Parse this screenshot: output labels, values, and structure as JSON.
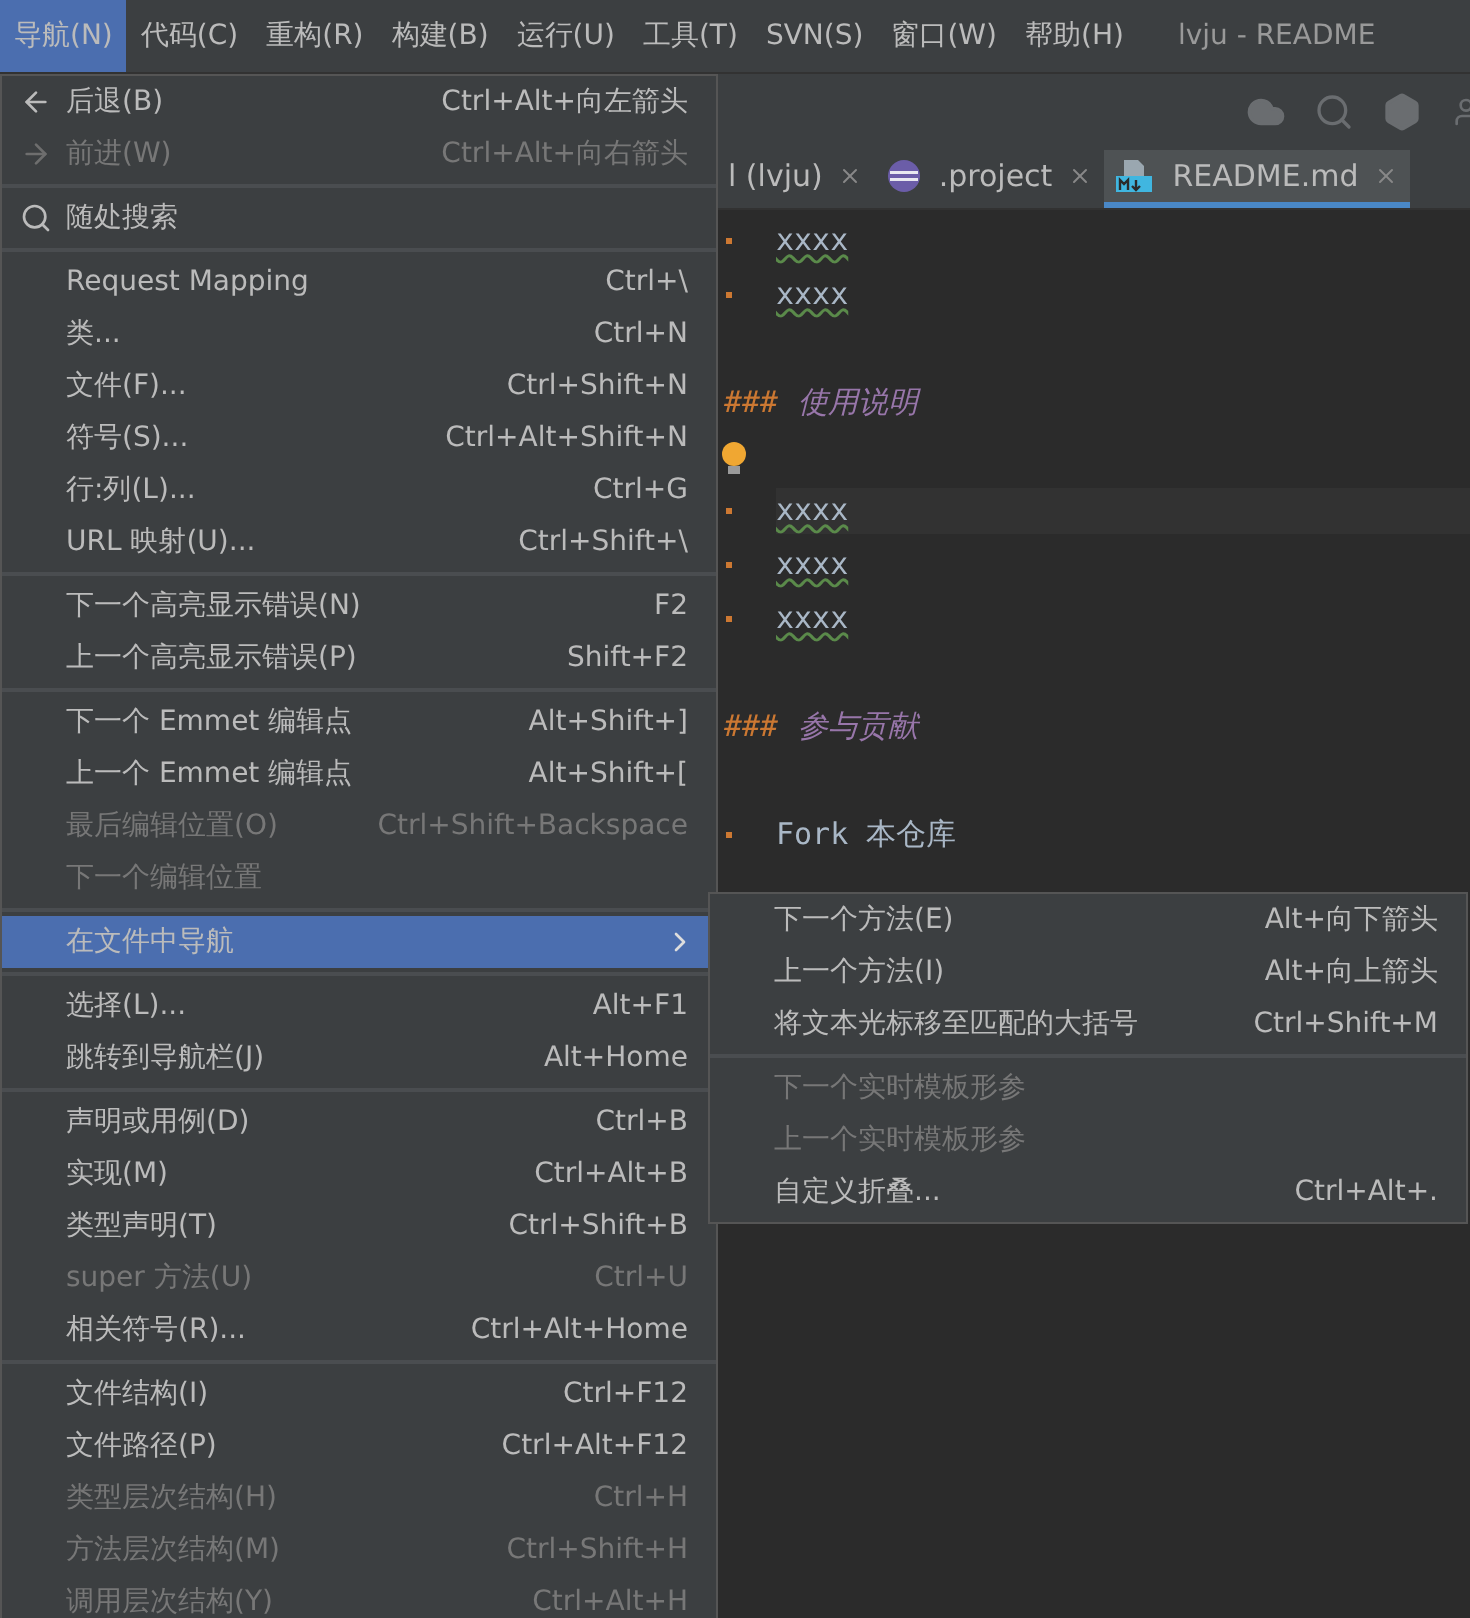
{
  "menubar": {
    "items": [
      {
        "label": "导航(N)",
        "selected": true
      },
      {
        "label": "代码(C)",
        "selected": false
      },
      {
        "label": "重构(R)",
        "selected": false
      },
      {
        "label": "构建(B)",
        "selected": false
      },
      {
        "label": "运行(U)",
        "selected": false
      },
      {
        "label": "工具(T)",
        "selected": false
      },
      {
        "label": "SVN(S)",
        "selected": false
      },
      {
        "label": "窗口(W)",
        "selected": false
      },
      {
        "label": "帮助(H)",
        "selected": false
      }
    ],
    "title": "lvju - README"
  },
  "tabs": [
    {
      "label": "l (lvju)",
      "selected": false,
      "kind": "plain"
    },
    {
      "label": ".project",
      "selected": false,
      "kind": "eclipse"
    },
    {
      "label": "README.md",
      "selected": true,
      "kind": "markdown"
    }
  ],
  "editor": {
    "lines": [
      {
        "kind": "bullet",
        "text": "xxxx",
        "current": false
      },
      {
        "kind": "bullet",
        "text": "xxxx",
        "current": false
      },
      {
        "kind": "blank"
      },
      {
        "kind": "heading",
        "hashes": "###",
        "text": "使用说明"
      },
      {
        "kind": "bulb"
      },
      {
        "kind": "bullet",
        "text": "xxxx",
        "current": true
      },
      {
        "kind": "bullet",
        "text": "xxxx",
        "current": false
      },
      {
        "kind": "bullet",
        "text": "xxxx",
        "current": false
      },
      {
        "kind": "blank"
      },
      {
        "kind": "heading",
        "hashes": "###",
        "text": "参与贡献"
      },
      {
        "kind": "blank"
      },
      {
        "kind": "bullet",
        "text": "Fork 本仓库",
        "current": false,
        "misspelled": false
      }
    ]
  },
  "menu": {
    "groups": [
      [
        {
          "label": "后退(B)",
          "shortcut": "Ctrl+Alt+向左箭头",
          "disabled": false,
          "selected": false,
          "kind": "back"
        },
        {
          "label": "前进(W)",
          "shortcut": "Ctrl+Alt+向右箭头",
          "disabled": true,
          "selected": false,
          "kind": "forward"
        }
      ],
      [
        {
          "label": "随处搜索",
          "disabled": false,
          "selected": false,
          "kind": "search"
        }
      ],
      [
        {
          "label": "Request Mapping",
          "shortcut": "Ctrl+\\",
          "disabled": false,
          "selected": false
        },
        {
          "label": "类...",
          "shortcut": "Ctrl+N",
          "disabled": false,
          "selected": false
        },
        {
          "label": "文件(F)...",
          "shortcut": "Ctrl+Shift+N",
          "disabled": false,
          "selected": false
        },
        {
          "label": "符号(S)...",
          "shortcut": "Ctrl+Alt+Shift+N",
          "disabled": false,
          "selected": false
        },
        {
          "label": "行:列(L)...",
          "shortcut": "Ctrl+G",
          "disabled": false,
          "selected": false
        },
        {
          "label": "URL 映射(U)...",
          "shortcut": "Ctrl+Shift+\\",
          "disabled": false,
          "selected": false
        }
      ],
      [
        {
          "label": "下一个高亮显示错误(N)",
          "shortcut": "F2",
          "disabled": false,
          "selected": false
        },
        {
          "label": "上一个高亮显示错误(P)",
          "shortcut": "Shift+F2",
          "disabled": false,
          "selected": false
        }
      ],
      [
        {
          "label": "下一个 Emmet 编辑点",
          "shortcut": "Alt+Shift+]",
          "disabled": false,
          "selected": false
        },
        {
          "label": "上一个 Emmet 编辑点",
          "shortcut": "Alt+Shift+[",
          "disabled": false,
          "selected": false
        },
        {
          "label": "最后编辑位置(O)",
          "shortcut": "Ctrl+Shift+Backspace",
          "disabled": true,
          "selected": false
        },
        {
          "label": "下一个编辑位置",
          "disabled": true,
          "selected": false
        }
      ],
      [
        {
          "label": "在文件中导航",
          "disabled": false,
          "selected": true,
          "kind": "submenu"
        }
      ],
      [
        {
          "label": "选择(L)...",
          "shortcut": "Alt+F1",
          "disabled": false,
          "selected": false
        },
        {
          "label": "跳转到导航栏(J)",
          "shortcut": "Alt+Home",
          "disabled": false,
          "selected": false
        }
      ],
      [
        {
          "label": "声明或用例(D)",
          "shortcut": "Ctrl+B",
          "disabled": false,
          "selected": false
        },
        {
          "label": "实现(M)",
          "shortcut": "Ctrl+Alt+B",
          "disabled": false,
          "selected": false
        },
        {
          "label": "类型声明(T)",
          "shortcut": "Ctrl+Shift+B",
          "disabled": false,
          "selected": false
        },
        {
          "label": "super 方法(U)",
          "shortcut": "Ctrl+U",
          "disabled": true,
          "selected": false
        },
        {
          "label": "相关符号(R)...",
          "shortcut": "Ctrl+Alt+Home",
          "disabled": false,
          "selected": false
        }
      ],
      [
        {
          "label": "文件结构(I)",
          "shortcut": "Ctrl+F12",
          "disabled": false,
          "selected": false
        },
        {
          "label": "文件路径(P)",
          "shortcut": "Ctrl+Alt+F12",
          "disabled": false,
          "selected": false
        },
        {
          "label": "类型层次结构(H)",
          "shortcut": "Ctrl+H",
          "disabled": true,
          "selected": false
        },
        {
          "label": "方法层次结构(M)",
          "shortcut": "Ctrl+Shift+H",
          "disabled": true,
          "selected": false
        },
        {
          "label": "调用层次结构(Y)",
          "shortcut": "Ctrl+Alt+H",
          "disabled": true,
          "selected": false
        }
      ]
    ]
  },
  "submenu": {
    "groups": [
      [
        {
          "label": "下一个方法(E)",
          "shortcut": "Alt+向下箭头",
          "disabled": false
        },
        {
          "label": "上一个方法(I)",
          "shortcut": "Alt+向上箭头",
          "disabled": false
        },
        {
          "label": "将文本光标移至匹配的大括号",
          "shortcut": "Ctrl+Shift+M",
          "disabled": false
        }
      ],
      [
        {
          "label": "下一个实时模板形参",
          "disabled": true
        },
        {
          "label": "上一个实时模板形参",
          "disabled": true
        },
        {
          "label": "自定义折叠...",
          "shortcut": "Ctrl+Alt+.",
          "disabled": false
        }
      ]
    ]
  }
}
